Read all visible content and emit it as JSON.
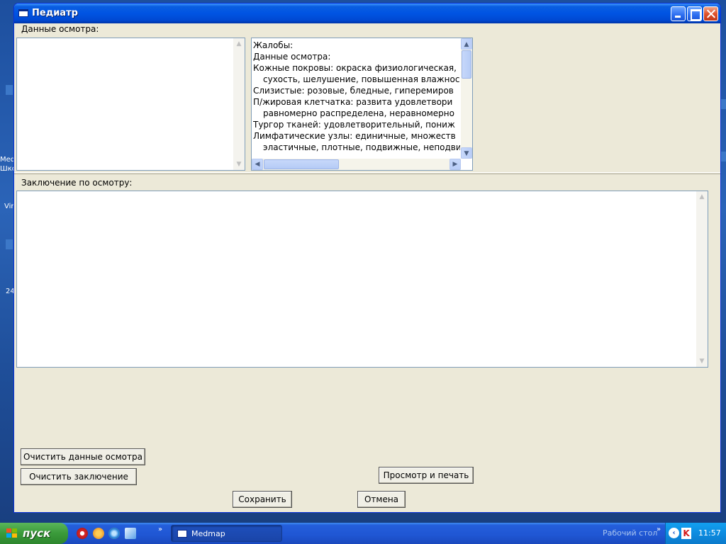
{
  "window": {
    "title": "Педиатр"
  },
  "exam": {
    "label": "Данные осмотра:",
    "input_value": ""
  },
  "template": {
    "lines": [
      {
        "text": "Жалобы:",
        "indent": false
      },
      {
        "text": "Данные осмотра:",
        "indent": false
      },
      {
        "text": "Кожные покровы: окраска физиологическая,",
        "indent": false
      },
      {
        "text": "сухость, шелушение, повышенная влажнос",
        "indent": true
      },
      {
        "text": "Слизистые: розовые, бледные, гиперемиров",
        "indent": false
      },
      {
        "text": "П/жировая клетчатка: развита удовлетвори",
        "indent": false
      },
      {
        "text": "равномерно распределена, неравномернo",
        "indent": true
      },
      {
        "text": "Тургор тканей: удовлетворительный, пониж",
        "indent": false
      },
      {
        "text": "Лимфатические узлы: единичные, множеств",
        "indent": false
      },
      {
        "text": "эластичные, плотные, подвижные, неподви",
        "indent": true
      }
    ]
  },
  "conclusion": {
    "label": "Заключение по осмотру:",
    "input_value": ""
  },
  "buttons": {
    "clear_exam": "Очистить данные осмотра",
    "clear_conclusion": "Очистить заключение",
    "preview_print": "Просмотр и печать",
    "save": "Сохранить",
    "cancel": "Отмена"
  },
  "desktop": {
    "fragments": [
      "Med",
      "Шко",
      "Vir",
      "24"
    ]
  },
  "taskbar": {
    "start_label": "пуск",
    "task_label": "Medmap",
    "desktop_label": "Рабочий стол",
    "tray_k": "K",
    "clock": "11:57"
  },
  "icons": {
    "window_icon": "window-icon",
    "start_logo": "windows-logo-icon",
    "quicklaunch": [
      "opera-icon",
      "paw-icon",
      "ie-icon",
      "explorer-icon"
    ]
  },
  "colors": {
    "titlebar": "#0054e3",
    "window_bg": "#ece9d8",
    "start_green": "#3a9a3a",
    "taskbar_blue": "#245edb",
    "tray_blue": "#0d8ce0"
  }
}
